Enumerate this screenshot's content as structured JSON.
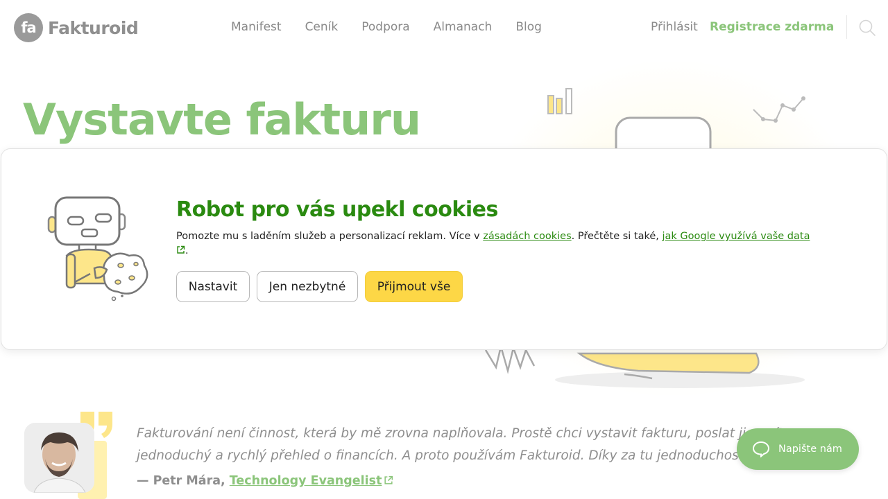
{
  "header": {
    "logo_mark": "fa",
    "logo_text": "Fakturoid",
    "nav": [
      "Manifest",
      "Ceník",
      "Podpora",
      "Almanach",
      "Blog"
    ],
    "login": "Přihlásit",
    "register": "Registrace zdarma",
    "search_icon": "search-icon"
  },
  "hero": {
    "title": "Vystavte fakturu"
  },
  "cookie": {
    "title": "Robot pro vás upekl cookies",
    "text_before": "Pomozte mu s laděním služeb a personalizací reklam. Více v ",
    "link1": "zásadách cookies",
    "text_middle": ". Přečtěte si také, ",
    "link2": "jak Google využívá vaše data",
    "text_after": ".",
    "buttons": {
      "settings": "Nastavit",
      "necessary": "Jen nezbytné",
      "accept_all": "Přijmout vše"
    }
  },
  "testimonial": {
    "quote": "Fakturování není činnost, která by mě zrovna naplňovala. Prostě chci vystavit fakturu, poslat ji a mít jednoduchý a rychlý přehled o financích. A proto používám Fakturoid. Díky za tu jednoduchost!",
    "author_prefix": "— Petr Mára, ",
    "author_link": "Technology Evangelist"
  },
  "chat": {
    "label": "Napište nám"
  },
  "colors": {
    "brand_green": "#8bc57a",
    "cookie_green": "#2a8a10",
    "accent_yellow": "#fdd746",
    "logo_gray": "#9a9a9a"
  }
}
